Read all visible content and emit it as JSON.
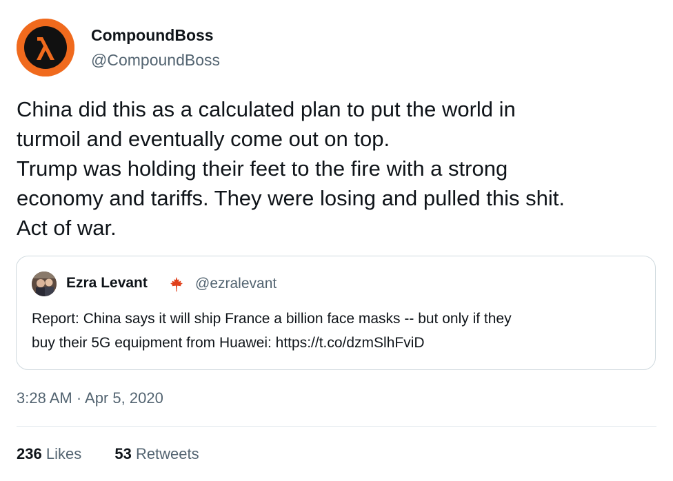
{
  "author": {
    "display_name": "CompoundBoss",
    "handle": "@CompoundBoss",
    "avatar_icon": "lambda-logo-icon",
    "avatar_color": "#f06a1d"
  },
  "tweet": {
    "lines": [
      "China did this as a calculated plan to put the world in",
      "turmoil and eventually come out on top.",
      "Trump was holding their feet to the fire with a strong",
      "economy and tariffs. They were losing and pulled this shit.",
      "Act of war."
    ]
  },
  "quoted_tweet": {
    "display_name": "Ezra Levant",
    "badge_icon": "maple-leaf-icon",
    "handle": "@ezralevant",
    "lines": [
      "Report: China says it will ship France a billion face masks -- but only if they",
      "buy their 5G equipment from Huawei:  https://t.co/dzmSlhFviD"
    ]
  },
  "meta": {
    "timestamp": "3:28 AM · Apr 5, 2020"
  },
  "stats": {
    "likes_count": "236",
    "likes_label": "Likes",
    "retweets_count": "53",
    "retweets_label": "Retweets"
  }
}
